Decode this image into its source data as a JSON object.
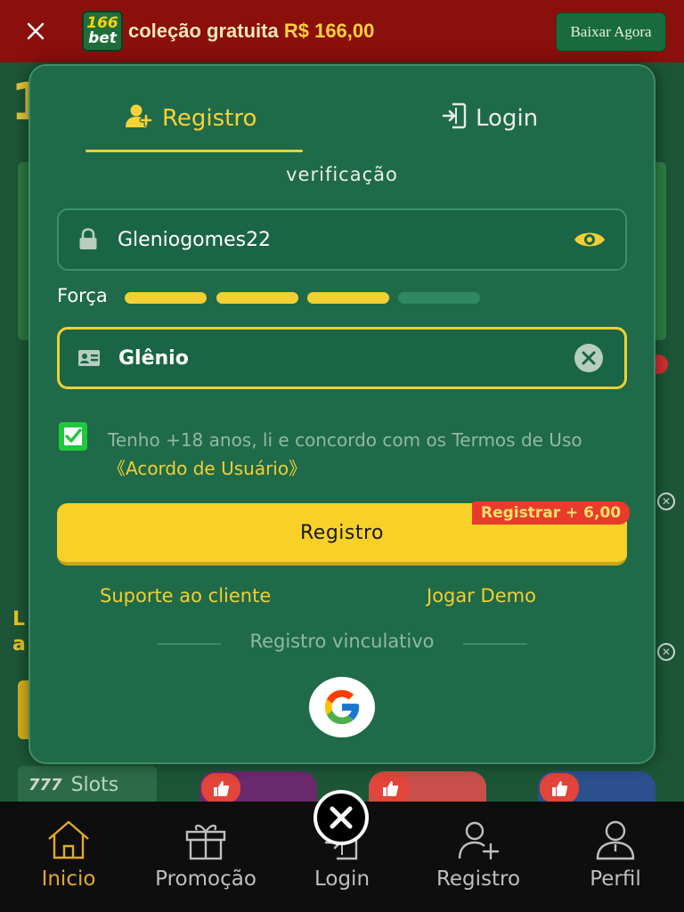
{
  "banner": {
    "logo_top": "166",
    "logo_bottom": "bet",
    "text": "coleção gratuita ",
    "amount": "R$ 166,00",
    "download_label": "Baixar Agora"
  },
  "background": {
    "slots_label": "Slots"
  },
  "modal": {
    "tabs": {
      "register_label": "Registro",
      "login_label": "Login"
    },
    "verification_text": "verificação",
    "username": {
      "value": "Gleniogomes22",
      "icon": "lock-icon",
      "action_icon": "eye-icon"
    },
    "strength": {
      "label": "Força",
      "filled_segments": 3,
      "total_segments": 4
    },
    "name": {
      "value": "Glênio",
      "icon": "id-card-icon",
      "action_icon": "clear-icon"
    },
    "terms": {
      "checked": true,
      "text": "Tenho +18 anos, li e concordo com os Termos de Uso ",
      "link": "《Acordo de Usuário》"
    },
    "register_button": "Registro",
    "bonus_badge": "Registrar +  6,00",
    "support_link": "Suporte ao cliente",
    "demo_link": "Jogar Demo",
    "divider_text": "Registro vinculativo",
    "social_login": "google-icon"
  },
  "nav": {
    "items": [
      {
        "label": "Inicio",
        "icon": "home-icon",
        "active": true
      },
      {
        "label": "Promoção",
        "icon": "gift-icon",
        "active": false
      },
      {
        "label": "Login",
        "icon": "login-icon",
        "active": false
      },
      {
        "label": "Registro",
        "icon": "user-plus-icon",
        "active": false
      },
      {
        "label": "Perfil",
        "icon": "user-icon",
        "active": false
      }
    ]
  },
  "colors": {
    "accent": "#f3cf33",
    "modal_bg": "#1f6a49",
    "banner_bg": "#8b0f0b",
    "active_nav": "#e2a929",
    "checkbox": "#20c83e",
    "badge": "#e83b2b"
  }
}
